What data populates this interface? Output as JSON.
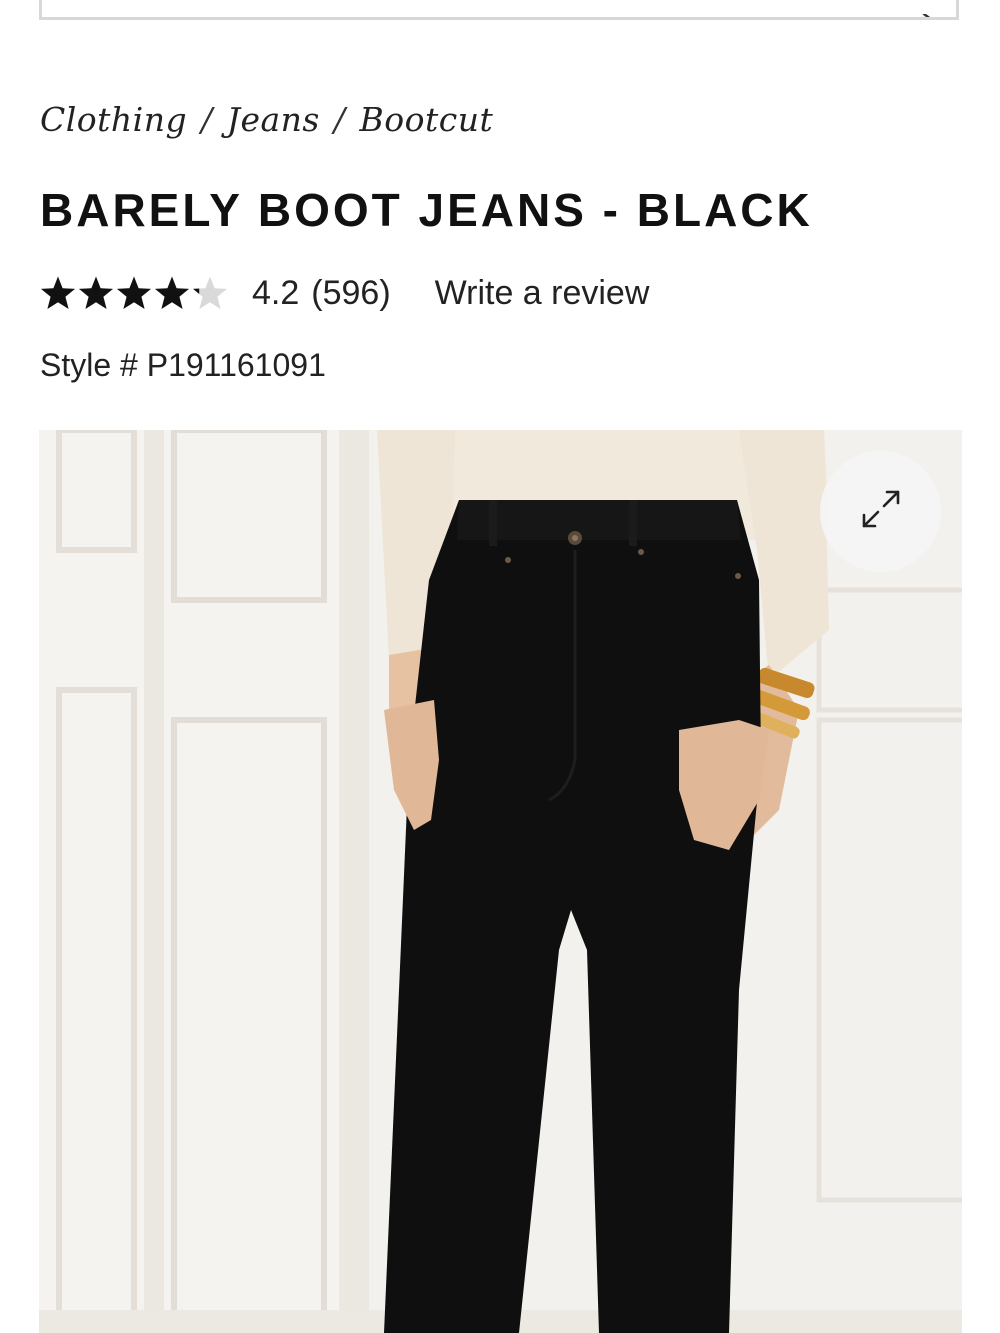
{
  "breadcrumb": {
    "items": [
      "Clothing",
      "Jeans",
      "Bootcut"
    ],
    "separator": "/"
  },
  "product": {
    "title": "BARELY BOOT JEANS - BLACK",
    "rating_value": "4.2",
    "rating_fraction": 0.84,
    "review_count": "(596)",
    "write_review_label": "Write a review",
    "style_label": "Style # P191161091"
  },
  "icons": {
    "search": "search-icon",
    "expand": "expand-icon",
    "star_filled": "star-filled-icon",
    "star_empty": "star-empty-icon"
  },
  "colors": {
    "text": "#111111",
    "star_filled": "#111111",
    "star_empty": "#d9d9d9",
    "jeans": "#0f0f0f",
    "sweater": "#f1e9dc",
    "wall": "#f3f1ed"
  }
}
